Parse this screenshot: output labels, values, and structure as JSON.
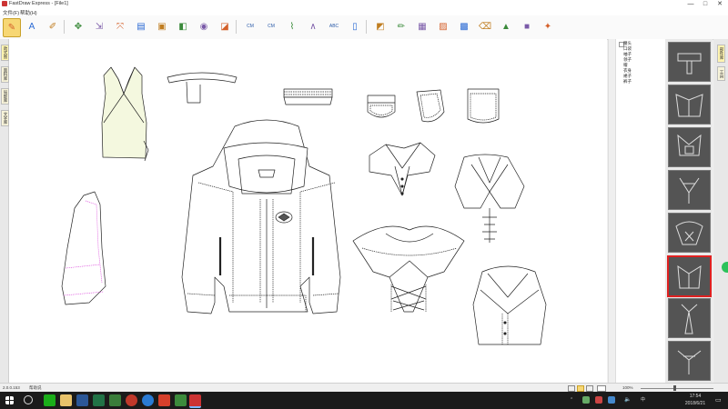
{
  "window": {
    "title": "FastDraw Express - [File1]",
    "controls": {
      "minimize": "—",
      "maximize": "□",
      "close": "✕"
    }
  },
  "menu": [
    "文件(F)",
    "帮助(H)"
  ],
  "toolbar": {
    "buttons": [
      {
        "name": "pencil-tool",
        "icon": "✎",
        "active": true
      },
      {
        "name": "text-tool",
        "icon": "A"
      },
      {
        "name": "paint-tool",
        "icon": "✐"
      },
      {
        "name": "move-tool",
        "icon": "✥"
      },
      {
        "name": "scale-tool",
        "icon": "⇲"
      },
      {
        "name": "transform-tool",
        "icon": "⤧"
      },
      {
        "name": "shape-tool",
        "icon": "▤"
      },
      {
        "name": "template-tool",
        "icon": "▣"
      },
      {
        "name": "fill-tool",
        "icon": "◧"
      },
      {
        "name": "stitch-tool",
        "icon": "◉"
      },
      {
        "name": "export-tool",
        "icon": "◪"
      },
      {
        "name": "measure-tool",
        "icon": "CM",
        "kind": "text"
      },
      {
        "name": "measure-alt-tool",
        "icon": "CM",
        "kind": "text"
      },
      {
        "name": "node-tool",
        "icon": "⌇"
      },
      {
        "name": "angle-tool",
        "icon": "∧"
      },
      {
        "name": "label-tool",
        "icon": "ABC",
        "kind": "text"
      },
      {
        "name": "page-tool",
        "icon": "▯"
      },
      {
        "name": "layer-tool",
        "icon": "◩"
      },
      {
        "name": "brush-tool",
        "icon": "✏"
      },
      {
        "name": "frame-tool",
        "icon": "▦"
      },
      {
        "name": "image-tool",
        "icon": "▨"
      },
      {
        "name": "group-tool",
        "icon": "▩"
      },
      {
        "name": "eraser-tool",
        "icon": "⌫"
      },
      {
        "name": "mountain-tool",
        "icon": "▲"
      },
      {
        "name": "color-tool",
        "icon": "■"
      },
      {
        "name": "wand-tool",
        "icon": "✦"
      }
    ]
  },
  "left_tabs": [
    "款式图",
    "面料库",
    "局部库",
    "文字库"
  ],
  "right_tabs": [
    "部件库",
    "工具"
  ],
  "tree": {
    "items": [
      "腰头",
      "口袋",
      "袖子",
      "领子",
      "帽",
      "衣身",
      "裙子",
      "裤子"
    ]
  },
  "thumbnails": {
    "count": 8,
    "selected_index": 5
  },
  "status": {
    "coords": "2.0.0.153",
    "message": "帮助说",
    "zoom": "100%"
  },
  "taskbar": {
    "time": "17:54",
    "date": "2018/6/21"
  },
  "colors": {
    "accent": "#f7d774",
    "selection": "#e02020",
    "thumb_bg": "#545454",
    "dress_fill": "#f4f8df",
    "stitch_pink": "#e060e0"
  }
}
